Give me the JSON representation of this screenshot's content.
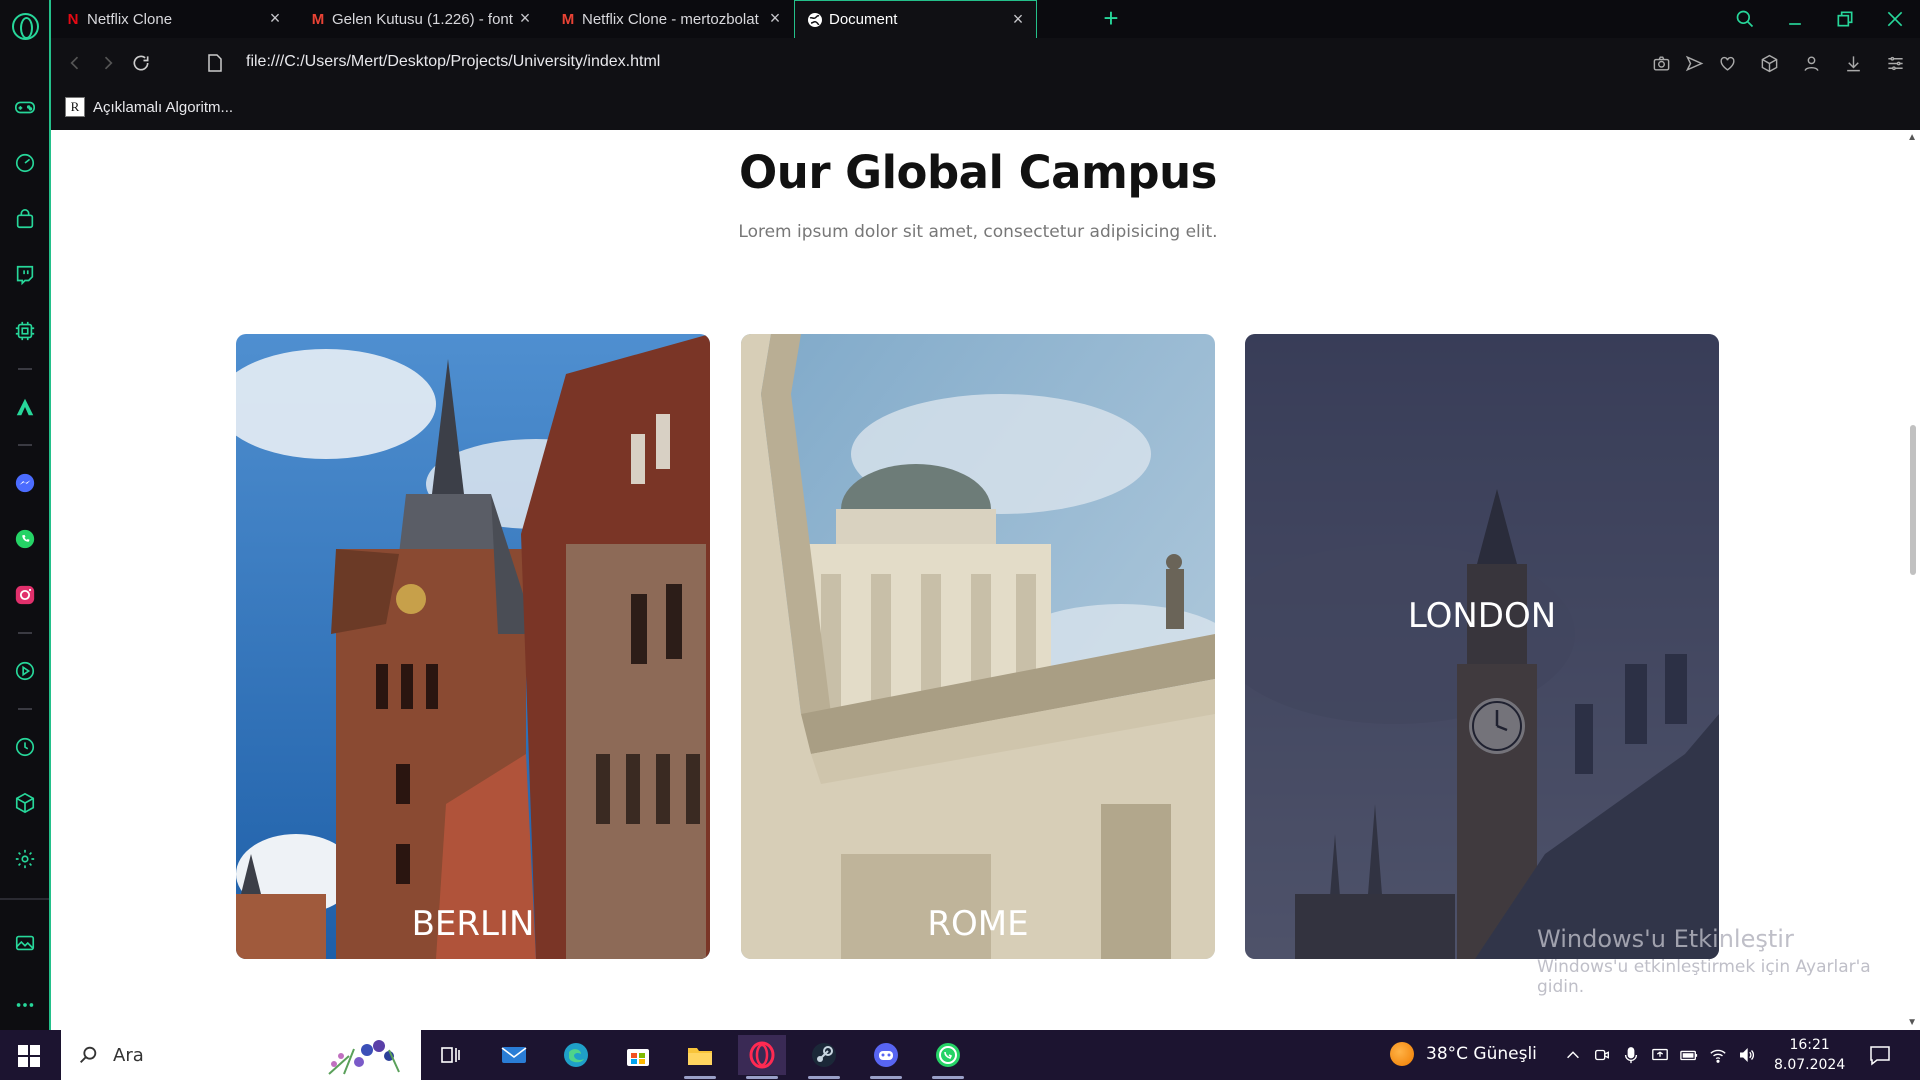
{
  "browser": {
    "tabs": [
      {
        "title": "Netflix Clone",
        "favicon": "netflix-icon",
        "active": false
      },
      {
        "title": "Gelen Kutusu (1.226) - font",
        "favicon": "gmail-icon",
        "active": false
      },
      {
        "title": "Netflix Clone - mertozbolat",
        "favicon": "gmail-icon",
        "active": false
      },
      {
        "title": "Document",
        "favicon": "globe-icon",
        "active": true
      }
    ],
    "url": "file:///C:/Users/Mert/Desktop/Projects/University/index.html",
    "bookmark": {
      "label": "Açıklamalı Algoritm...",
      "icon_text": "R"
    },
    "accent_color": "#24c08a"
  },
  "page": {
    "title": "Our Global Campus",
    "subtitle": "Lorem ipsum dolor sit amet, consectetur adipisicing elit.",
    "campuses": [
      {
        "name": "BERLIN",
        "hovered": false
      },
      {
        "name": "ROME",
        "hovered": false
      },
      {
        "name": "LONDON",
        "hovered": true
      }
    ]
  },
  "watermark": {
    "line1": "Windows'u Etkinleştir",
    "line2": "Windows'u etkinleştirmek için Ayarlar'a gidin."
  },
  "taskbar": {
    "search_placeholder": "Ara",
    "weather": "38°C  Güneşli",
    "time": "16:21",
    "date": "8.07.2024",
    "apps": [
      "task-view",
      "mail",
      "edge",
      "store",
      "file-explorer",
      "opera",
      "steam",
      "discord",
      "whatsapp"
    ]
  }
}
